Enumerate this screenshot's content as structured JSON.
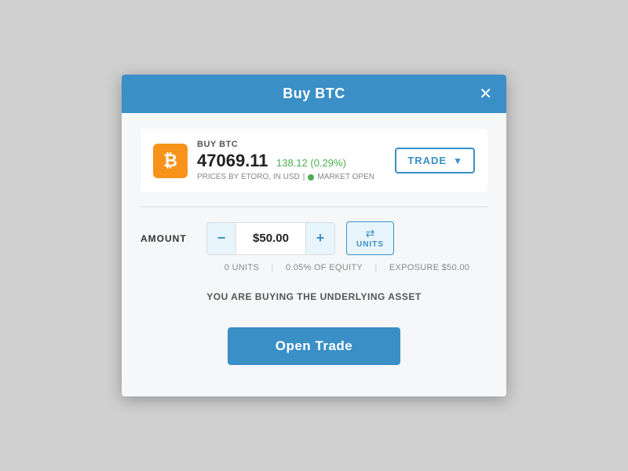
{
  "modal": {
    "title": "Buy BTC",
    "close_label": "✕"
  },
  "asset": {
    "label": "BUY BTC",
    "icon": "₿",
    "price": "47069.11",
    "change": "138.12 (0.29%)",
    "meta_source": "PRICES BY ETORO, IN USD",
    "market_status": "MARKET OPEN"
  },
  "trade_dropdown": {
    "label": "TRADE",
    "arrow": "▼"
  },
  "amount": {
    "label": "AMOUNT",
    "minus": "−",
    "value": "$50.00",
    "plus": "+",
    "units_icon": "⇄",
    "units_label": "UNITS"
  },
  "meta": {
    "units": "0 UNITS",
    "equity": "0.05% OF EQUITY",
    "exposure": "EXPOSURE $50.00"
  },
  "message": "YOU ARE BUYING THE UNDERLYING ASSET",
  "open_trade_btn": "Open Trade"
}
